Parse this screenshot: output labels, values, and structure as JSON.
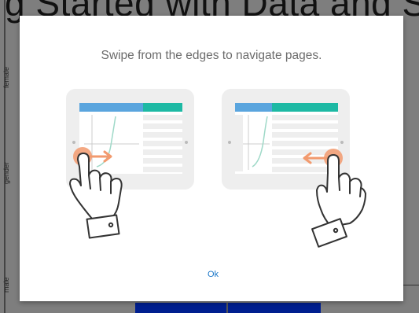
{
  "background": {
    "title": "g Started with Data and S",
    "y_labels": {
      "female": "female",
      "gender": "gender",
      "male": "male"
    },
    "bar_color": "#001f8f"
  },
  "modal": {
    "message": "Swipe from the edges to navigate pages.",
    "ok_label": "Ok",
    "colors": {
      "header_blue": "#5aa5de",
      "header_teal": "#1db9a4",
      "touch_orange": "#f29a6e",
      "tablet_frame": "#eeeeee",
      "curve": "#9fd9c8",
      "link": "#1976c8"
    },
    "icons": {
      "left_hand": "pointing-hand-icon",
      "right_hand": "pointing-hand-icon",
      "left_arrow": "arrow-right-icon",
      "right_arrow": "arrow-left-icon"
    }
  }
}
